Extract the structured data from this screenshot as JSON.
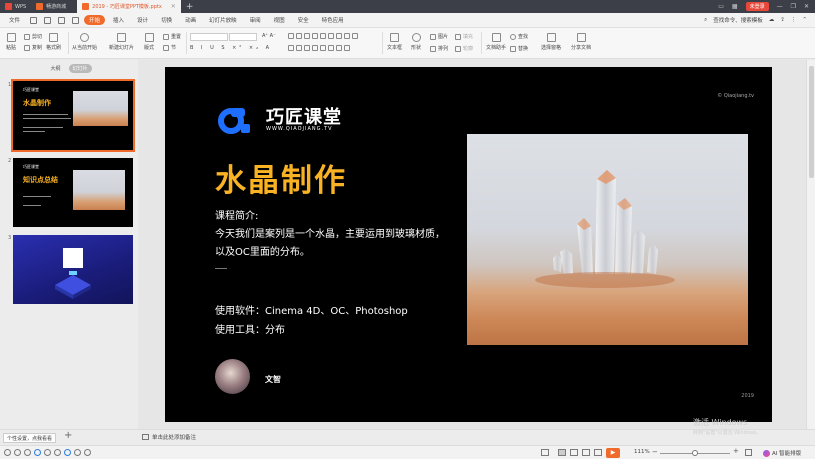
{
  "colors": {
    "accent": "#f06b2b",
    "slide_title": "#f9b224",
    "logo_blue": "#1f6fff"
  },
  "tabs": [
    {
      "label": "WPS",
      "icon": "wps-icon"
    },
    {
      "label": "畅游商城",
      "icon": "shop-icon"
    },
    {
      "label": "2019 - 巧匠课堂PPT模板.pptx",
      "icon": "ppt-icon"
    }
  ],
  "titlebar": {
    "login": "未登录"
  },
  "menu": {
    "file": "文件",
    "items": [
      "开始",
      "插入",
      "设计",
      "切换",
      "动画",
      "幻灯片放映",
      "审阅",
      "视图",
      "安全",
      "特色应用"
    ],
    "search": "查找命令、搜索模板"
  },
  "ribbon": {
    "paste": "粘贴",
    "cut": "剪切",
    "copy": "复制",
    "format_painter": "格式刷",
    "from_current": "从当前开始",
    "new_slide": "新建幻灯片",
    "layout": "版式",
    "reset": "重置",
    "section": "节",
    "textbox": "文本框",
    "shape": "形状",
    "picture": "图片",
    "fill": "填充",
    "arrange": "排列",
    "outline": "轮廓",
    "doc_assistant": "文档助手",
    "find": "查找",
    "replace": "替换",
    "select_pane": "选择窗格",
    "share": "分享文档"
  },
  "panel": {
    "tab_outline": "大纲",
    "tab_slides": "幻灯片",
    "settings_btn": "个性设置，点我看看"
  },
  "thumbs": [
    {
      "num": "1",
      "title": "水晶制作",
      "logo": "巧匠课堂"
    },
    {
      "num": "2",
      "title": "知识点总结",
      "logo": "巧匠课堂"
    },
    {
      "num": "3"
    }
  ],
  "slide": {
    "brand": "巧匠课堂",
    "brand_sub": "WWW.QIAOJIANG.TV",
    "copyright": "© Qiaojiang.tv",
    "title": "水晶制作",
    "intro_label": "课程简介:",
    "intro_line1": "今天我们是案列是一个水晶，主要运用到玻璃材质，",
    "intro_line2": "以及OC里面的分布。",
    "software": "使用软件：Cinema 4D、OC、Photoshop",
    "tools": "使用工具：分布",
    "author": "文智",
    "year": "2019"
  },
  "notes": {
    "placeholder": "单击此处添加备注"
  },
  "watermark": {
    "line1": "激活 Windows",
    "line2": "转到\"设置\"以激活 Windows。"
  },
  "status": {
    "zoom": "111%",
    "ai": "AI 智能排版"
  }
}
